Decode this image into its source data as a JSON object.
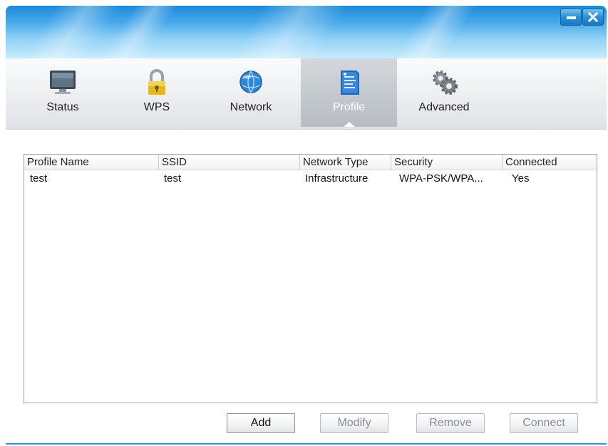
{
  "window": {
    "minimize_icon": "minimize-icon",
    "close_icon": "close-icon"
  },
  "tabs": [
    {
      "label": "Status",
      "icon": "monitor-icon",
      "active": false
    },
    {
      "label": "WPS",
      "icon": "padlock-icon",
      "active": false
    },
    {
      "label": "Network",
      "icon": "globe-icon",
      "active": false
    },
    {
      "label": "Profile",
      "icon": "profile-document-icon",
      "active": true
    },
    {
      "label": "Advanced",
      "icon": "gears-icon",
      "active": false
    }
  ],
  "profiles": {
    "columns": [
      "Profile Name",
      "SSID",
      "Network Type",
      "Security",
      "Connected"
    ],
    "rows": [
      {
        "profile_name": "test",
        "ssid": "test",
        "network_type": "Infrastructure",
        "security": "WPA-PSK/WPA...",
        "connected": "Yes"
      }
    ]
  },
  "buttons": {
    "add": "Add",
    "modify": "Modify",
    "remove": "Remove",
    "connect": "Connect"
  },
  "colors": {
    "titlebar": "#45a7ea",
    "active_tab": "#b6bcc2"
  }
}
